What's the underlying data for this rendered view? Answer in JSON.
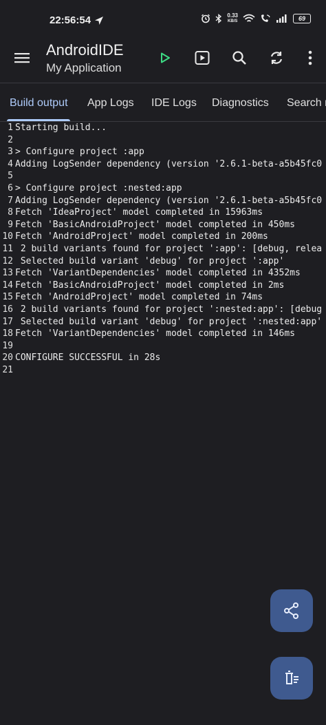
{
  "status_bar": {
    "time": "22:56:54",
    "net_speed_value": "0.33",
    "net_speed_unit": "KB/S",
    "battery": "69"
  },
  "toolbar": {
    "title": "AndroidIDE",
    "subtitle": "My Application",
    "run_color": "#3ddc84"
  },
  "tabs": [
    {
      "label": "Build output"
    },
    {
      "label": "App Logs"
    },
    {
      "label": "IDE Logs"
    },
    {
      "label": "Diagnostics"
    },
    {
      "label": "Search r"
    }
  ],
  "accent": "#aecbfa",
  "log_lines": [
    {
      "n": "1",
      "text": "Starting build..."
    },
    {
      "n": "2",
      "text": ""
    },
    {
      "n": "3",
      "text": "> Configure project :app"
    },
    {
      "n": "4",
      "text": "Adding LogSender dependency (version '2.6.1-beta-a5b45fc0"
    },
    {
      "n": "5",
      "text": ""
    },
    {
      "n": "6",
      "text": "> Configure project :nested:app"
    },
    {
      "n": "7",
      "text": "Adding LogSender dependency (version '2.6.1-beta-a5b45fc0"
    },
    {
      "n": "8",
      "text": "Fetch 'IdeaProject' model completed in 15963ms"
    },
    {
      "n": "9",
      "text": "Fetch 'BasicAndroidProject' model completed in 450ms"
    },
    {
      "n": "10",
      "text": "Fetch 'AndroidProject' model completed in 200ms"
    },
    {
      "n": "11",
      "text": " 2 build variants found for project ':app': [debug, relea"
    },
    {
      "n": "12",
      "text": " Selected build variant 'debug' for project ':app'"
    },
    {
      "n": "13",
      "text": "Fetch 'VariantDependencies' model completed in 4352ms"
    },
    {
      "n": "14",
      "text": "Fetch 'BasicAndroidProject' model completed in 2ms"
    },
    {
      "n": "15",
      "text": "Fetch 'AndroidProject' model completed in 74ms"
    },
    {
      "n": "16",
      "text": " 2 build variants found for project ':nested:app': [debug"
    },
    {
      "n": "17",
      "text": " Selected build variant 'debug' for project ':nested:app'"
    },
    {
      "n": "18",
      "text": "Fetch 'VariantDependencies' model completed in 146ms"
    },
    {
      "n": "19",
      "text": ""
    },
    {
      "n": "20",
      "text": "CONFIGURE SUCCESSFUL in 28s"
    },
    {
      "n": "21",
      "text": ""
    }
  ],
  "fab_color": "#3f5a8f"
}
